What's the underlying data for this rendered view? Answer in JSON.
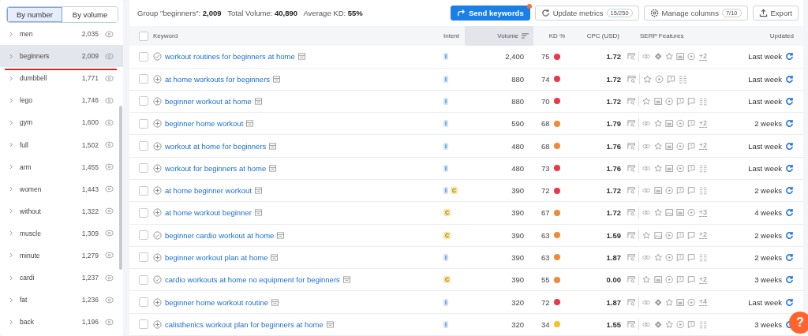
{
  "group_tabs": [
    {
      "label": "By number",
      "selected": true
    },
    {
      "label": "By volume",
      "selected": false
    }
  ],
  "groups": [
    {
      "label": "men",
      "count": "2,035",
      "selected": false
    },
    {
      "label": "beginners",
      "count": "2,009",
      "selected": true
    },
    {
      "label": "dumbbell",
      "count": "1,771",
      "selected": false
    },
    {
      "label": "lego",
      "count": "1,746",
      "selected": false
    },
    {
      "label": "gym",
      "count": "1,600",
      "selected": false
    },
    {
      "label": "full",
      "count": "1,502",
      "selected": false
    },
    {
      "label": "arm",
      "count": "1,455",
      "selected": false
    },
    {
      "label": "women",
      "count": "1,443",
      "selected": false
    },
    {
      "label": "without",
      "count": "1,322",
      "selected": false
    },
    {
      "label": "muscle",
      "count": "1,309",
      "selected": false
    },
    {
      "label": "minute",
      "count": "1,279",
      "selected": false
    },
    {
      "label": "cardi",
      "count": "1,237",
      "selected": false
    },
    {
      "label": "fat",
      "count": "1,236",
      "selected": false
    },
    {
      "label": "back",
      "count": "1,196",
      "selected": false
    }
  ],
  "summary": "Group \"beginners\": **2,009**   Total Volume: **40,890**   Average KD: **55%**",
  "toolbar": [
    {
      "kind": "primary",
      "label": "Send keywords",
      "notification": true
    },
    {
      "kind": "refresh",
      "label": "Update metrics",
      "badge": "15/250"
    },
    {
      "kind": "settings",
      "label": "Manage columns",
      "badge": "7/10"
    },
    {
      "kind": "export",
      "label": "Export"
    }
  ],
  "header_checkbox": {
    "checked": false
  },
  "columns": [
    {
      "label": "Keyword",
      "sorted": false
    },
    {
      "label": "Intent",
      "sorted": false
    },
    {
      "label": "Volume",
      "sorted": true
    },
    {
      "label": "KD %",
      "sorted": false
    },
    {
      "label": "CPC (USD)",
      "sorted": false
    },
    {
      "label": "SERP Features",
      "sorted": false
    },
    {
      "label": "Updated",
      "sorted": false
    }
  ],
  "rows": [
    {
      "checked": false,
      "keyword": "workout routines for beginners at home",
      "added": true,
      "intents": [
        "I"
      ],
      "volume": "2,400",
      "kd": "75",
      "color": "#e8394a",
      "cpc": "1.72",
      "serp": [
        {
          "kind": "link"
        },
        {
          "kind": "diamond"
        },
        {
          "kind": "star"
        },
        {
          "kind": "image"
        },
        {
          "kind": "video"
        }
      ],
      "more": "+2",
      "updated": "Last week"
    },
    {
      "checked": false,
      "keyword": "at home workouts for beginners",
      "added": false,
      "intents": [
        "I"
      ],
      "volume": "880",
      "kd": "74",
      "color": "#e8394a",
      "cpc": "1.72",
      "serp": [
        {
          "kind": "star"
        },
        {
          "kind": "video"
        },
        {
          "kind": "faq"
        },
        {
          "kind": "list"
        }
      ],
      "updated": "Last week"
    },
    {
      "checked": false,
      "keyword": "beginner workout at home",
      "added": false,
      "intents": [
        "I"
      ],
      "volume": "880",
      "kd": "70",
      "color": "#e8394a",
      "cpc": "1.72",
      "serp": [
        {
          "kind": "star"
        },
        {
          "kind": "image"
        },
        {
          "kind": "video"
        },
        {
          "kind": "faq"
        },
        {
          "kind": "comment"
        },
        {
          "kind": "list"
        }
      ],
      "updated": "Last week"
    },
    {
      "checked": false,
      "keyword": "beginner home workout",
      "added": false,
      "intents": [
        "I"
      ],
      "volume": "590",
      "kd": "68",
      "color": "#f08a3b",
      "cpc": "1.79",
      "serp": [
        {
          "kind": "link"
        },
        {
          "kind": "star"
        },
        {
          "kind": "image"
        },
        {
          "kind": "video"
        },
        {
          "kind": "faq"
        }
      ],
      "more": "+2",
      "updated": "2 weeks"
    },
    {
      "checked": false,
      "keyword": "workout at home for beginners",
      "added": false,
      "intents": [
        "I"
      ],
      "volume": "480",
      "kd": "68",
      "color": "#f08a3b",
      "cpc": "1.76",
      "serp": [
        {
          "kind": "link"
        },
        {
          "kind": "star"
        },
        {
          "kind": "image"
        },
        {
          "kind": "video"
        },
        {
          "kind": "faq"
        }
      ],
      "more": "+2",
      "updated": "Last week"
    },
    {
      "checked": false,
      "keyword": "workout for beginners at home",
      "added": false,
      "intents": [
        "I"
      ],
      "volume": "480",
      "kd": "73",
      "color": "#e8394a",
      "cpc": "1.76",
      "serp": [
        {
          "kind": "link"
        },
        {
          "kind": "star"
        },
        {
          "kind": "image"
        },
        {
          "kind": "video"
        },
        {
          "kind": "faq"
        },
        {
          "kind": "list"
        }
      ],
      "updated": "Last week"
    },
    {
      "checked": false,
      "keyword": "at home beginner workout",
      "added": false,
      "intents": [
        "I",
        "C"
      ],
      "volume": "390",
      "kd": "72",
      "color": "#e8394a",
      "cpc": "1.72",
      "serp": [
        {
          "kind": "link"
        },
        {
          "kind": "image"
        },
        {
          "kind": "video"
        },
        {
          "kind": "faq"
        },
        {
          "kind": "comment"
        },
        {
          "kind": "list"
        }
      ],
      "updated": "2 weeks"
    },
    {
      "checked": false,
      "keyword": "at home workout beginner",
      "added": false,
      "intents": [
        "C"
      ],
      "volume": "390",
      "kd": "67",
      "color": "#f08a3b",
      "cpc": "1.72",
      "serp": [
        {
          "kind": "link"
        },
        {
          "kind": "star"
        },
        {
          "kind": "photo"
        },
        {
          "kind": "image"
        },
        {
          "kind": "video"
        }
      ],
      "more": "+3",
      "updated": "4 weeks"
    },
    {
      "checked": false,
      "keyword": "beginner cardio workout at home",
      "added": true,
      "intents": [
        "C"
      ],
      "volume": "390",
      "kd": "63",
      "color": "#f08a3b",
      "cpc": "1.59",
      "serp": [
        {
          "kind": "star"
        },
        {
          "kind": "photo"
        },
        {
          "kind": "video"
        },
        {
          "kind": "faq"
        },
        {
          "kind": "comment"
        }
      ],
      "more": "+2",
      "updated": "2 weeks"
    },
    {
      "checked": false,
      "keyword": "beginner workout plan at home",
      "added": false,
      "intents": [
        "I"
      ],
      "volume": "390",
      "kd": "63",
      "color": "#f08a3b",
      "cpc": "1.87",
      "serp": [
        {
          "kind": "link"
        },
        {
          "kind": "star"
        },
        {
          "kind": "video"
        },
        {
          "kind": "faq"
        },
        {
          "kind": "comment"
        },
        {
          "kind": "list"
        }
      ],
      "updated": "2 weeks"
    },
    {
      "checked": false,
      "keyword": "cardio workouts at home no equipment for beginners",
      "added": true,
      "intents": [
        "C"
      ],
      "volume": "390",
      "kd": "55",
      "color": "#f08a3b",
      "cpc": "0.00",
      "serp": [
        {
          "kind": "star"
        },
        {
          "kind": "image"
        },
        {
          "kind": "video"
        },
        {
          "kind": "faq"
        },
        {
          "kind": "comment"
        }
      ],
      "more": "+2",
      "updated": "3 weeks"
    },
    {
      "checked": false,
      "keyword": "beginner home workout routine",
      "added": false,
      "intents": [
        "I"
      ],
      "volume": "320",
      "kd": "72",
      "color": "#e8394a",
      "cpc": "1.87",
      "serp": [
        {
          "kind": "link"
        },
        {
          "kind": "diamond"
        },
        {
          "kind": "star"
        },
        {
          "kind": "image"
        },
        {
          "kind": "video"
        }
      ],
      "more": "+4",
      "updated": "Last week"
    },
    {
      "checked": false,
      "keyword": "calisthenics workout plan for beginners at home",
      "added": false,
      "intents": [
        "I"
      ],
      "volume": "320",
      "kd": "34",
      "color": "#f5c12e",
      "cpc": "1.55",
      "serp": [
        {
          "kind": "link"
        },
        {
          "kind": "diamond"
        },
        {
          "kind": "star"
        },
        {
          "kind": "video"
        },
        {
          "kind": "faq"
        },
        {
          "kind": "list"
        }
      ],
      "updated": "3 weeks"
    }
  ],
  "help": {
    "label": "?"
  }
}
